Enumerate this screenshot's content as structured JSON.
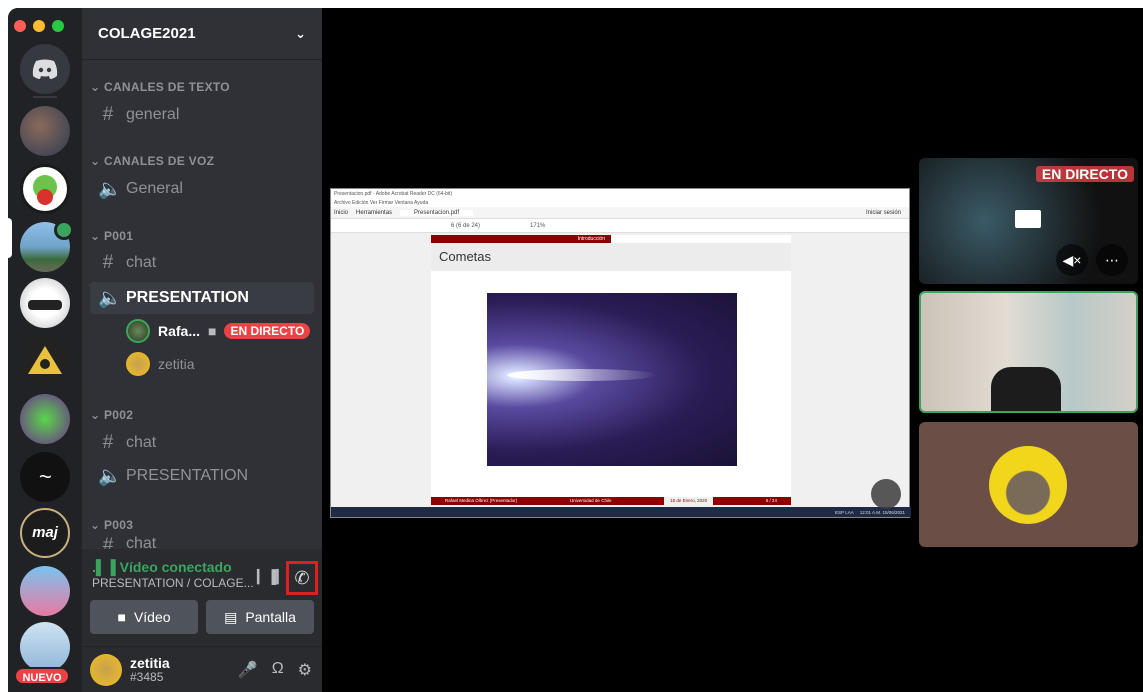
{
  "server_name": "COLAGE2021",
  "categories": {
    "text": "CANALES DE TEXTO",
    "voice": "CANALES DE VOZ",
    "p001": "P001",
    "p002": "P002",
    "p003": "P003"
  },
  "channels": {
    "general_text": "general",
    "general_voice": "General",
    "chat1": "chat",
    "presentation1": "PRESENTATION",
    "chat2": "chat",
    "presentation2": "PRESENTATION",
    "chat3": "chat"
  },
  "voice_users": [
    {
      "name": "Rafa...",
      "live": "EN DIRECTO"
    },
    {
      "name": "zetitia"
    }
  ],
  "nuevo_badge": "NUEVO",
  "connection": {
    "status": "Vídeo conectado",
    "location": "PRESENTATION / COLAGE..."
  },
  "buttons": {
    "video": "Vídeo",
    "screen": "Pantalla"
  },
  "user": {
    "name": "zetitia",
    "tag": "#3485"
  },
  "presentation": {
    "window_title": "Presentacion.pdf - Adobe Acrobat Reader DC (64-bit)",
    "menu": "Archivo  Edición  Ver  Firmar  Ventana  Ayuda",
    "tabs": [
      "Inicio",
      "Herramientas",
      "Presentacion.pdf"
    ],
    "signin": "Iniciar sesión",
    "page_info": "6 (6 de 24)",
    "zoom": "171%",
    "section": "Introducción",
    "slide_title": "Cometas",
    "footer_author": "Rafael Medina Olbrez (Presentador)",
    "footer_uni": "Universidad de Chile",
    "footer_date": "18 de Enero, 2020",
    "footer_page": "6 / 24",
    "taskbar_lang": "ESP LAA",
    "taskbar_time": "12:01 A.M. 15/06/2021"
  },
  "tile_live_label": "EN DIRECTO",
  "colors": {
    "accent_green": "#3ba55d",
    "live_red": "#ed4245",
    "sidebar": "#2f3136",
    "servers": "#202225",
    "highlight_box": "#e02020"
  }
}
